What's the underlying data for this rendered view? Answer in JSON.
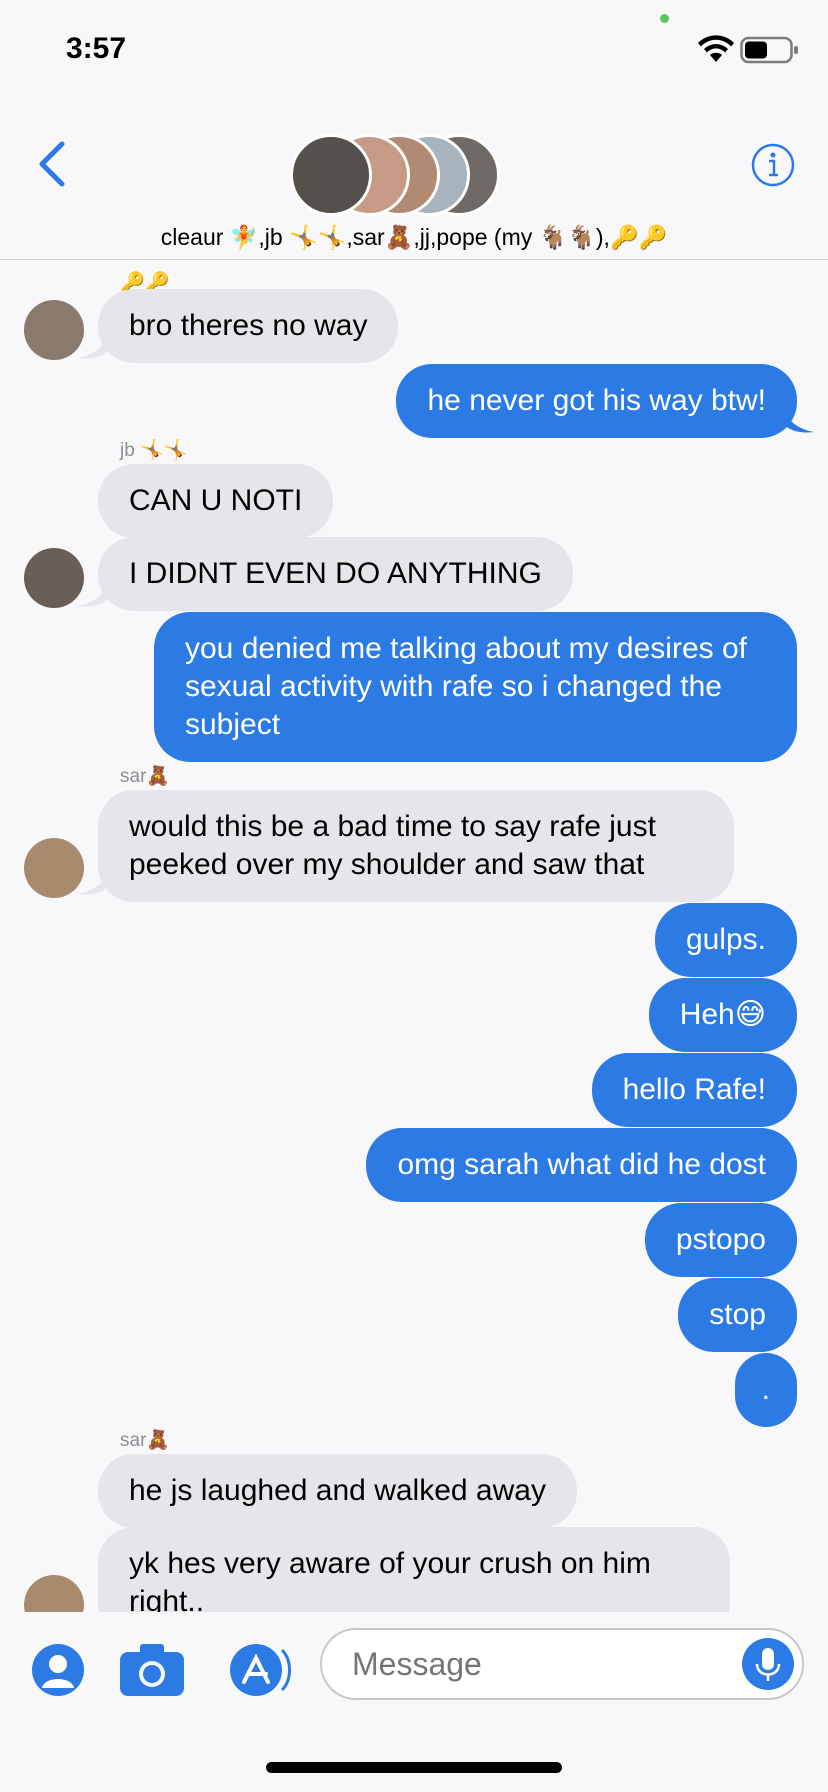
{
  "status_bar": {
    "time": "3:57"
  },
  "header": {
    "group_name": "cleaur 🧚,jb 🤸🤸,sar🧸,jj,pope (my 🐐🐐),🔑🔑",
    "peek_emoji": "🔑🔑"
  },
  "messages": [
    {
      "direction": "in",
      "text": "bro theres no way"
    },
    {
      "direction": "out",
      "text": "he never got his way btw!"
    },
    {
      "sender": "jb 🤸🤸"
    },
    {
      "direction": "in",
      "text": "CAN U NOTI"
    },
    {
      "direction": "in",
      "text": "I DIDNT EVEN DO ANYTHING"
    },
    {
      "direction": "out",
      "text": "you denied me talking about my desires of sexual activity with rafe so i changed the subject"
    },
    {
      "sender": "sar🧸"
    },
    {
      "direction": "in",
      "text": "would this be a bad time to say rafe just peeked over my shoulder and saw that"
    },
    {
      "direction": "out",
      "text": "gulps."
    },
    {
      "direction": "out",
      "text": "Heh😅"
    },
    {
      "direction": "out",
      "text": "hello Rafe!"
    },
    {
      "direction": "out",
      "text": "omg sarah what did he dost"
    },
    {
      "direction": "out",
      "text": "pstopo"
    },
    {
      "direction": "out",
      "text": "stop"
    },
    {
      "direction": "out",
      "text": "."
    },
    {
      "sender": "sar🧸"
    },
    {
      "direction": "in",
      "text": "he js laughed and walked away"
    },
    {
      "direction": "in",
      "text": "yk hes very aware of your crush on him right.."
    }
  ],
  "compose": {
    "placeholder": "Message",
    "icons": [
      "memoji-icon",
      "camera-icon",
      "app-store-icon",
      "microphone-icon"
    ]
  },
  "colors": {
    "outgoing": "#2c7be5",
    "incoming": "#e6e6ea",
    "accent": "#2c7be5"
  }
}
